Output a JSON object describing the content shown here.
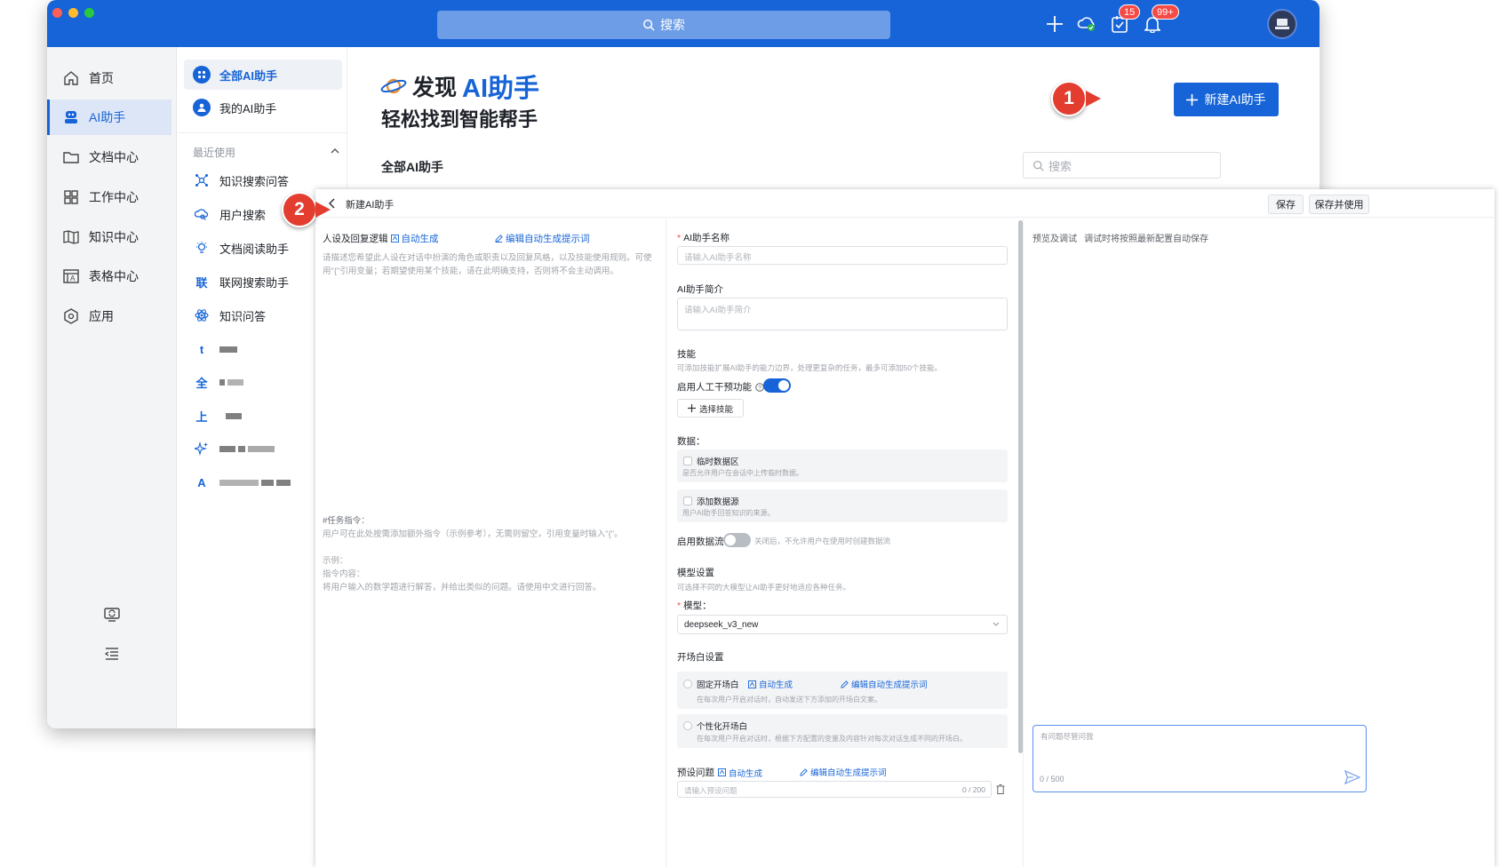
{
  "topbar": {
    "search_label": "搜索",
    "todo_badge": "15",
    "notify_badge": "99+"
  },
  "nav": {
    "items": [
      {
        "label": "首页",
        "icon": "home-icon"
      },
      {
        "label": "AI助手",
        "icon": "robot-icon"
      },
      {
        "label": "文档中心",
        "icon": "folder-icon"
      },
      {
        "label": "工作中心",
        "icon": "grid-icon"
      },
      {
        "label": "知识中心",
        "icon": "book-icon"
      },
      {
        "label": "表格中心",
        "icon": "table-icon"
      },
      {
        "label": "应用",
        "icon": "hexagon-icon"
      }
    ],
    "active_index": 1
  },
  "sub_sidebar": {
    "all_ai": "全部AI助手",
    "my_ai": "我的AI助手",
    "recent_heading": "最近使用",
    "recent_items": [
      {
        "label": "知识搜索问答",
        "icon": "knowledge-search-icon"
      },
      {
        "label": "用户搜索",
        "icon": "user-search-icon"
      },
      {
        "label": "文档阅读助手",
        "icon": "bulb-icon"
      },
      {
        "label": "联网搜索助手",
        "icon": "web-search-icon",
        "glyph": "联"
      },
      {
        "label": "知识问答",
        "icon": "atom-icon"
      }
    ],
    "blurred_glyphs": [
      "t",
      "全",
      "上",
      "",
      "A"
    ]
  },
  "hero": {
    "prefix": "发现",
    "accent": "AI助手",
    "subtitle": "轻松找到智能帮手"
  },
  "main": {
    "new_button": "新建AI助手",
    "all_label": "全部AI助手",
    "search_placeholder": "搜索"
  },
  "callouts": {
    "one": "1",
    "two": "2"
  },
  "editor": {
    "title": "新建AI助手",
    "save": "保存",
    "save_and_use": "保存并使用",
    "persona": {
      "label": "人设及回复逻辑",
      "auto_generate": "自动生成",
      "edit_prompt": "编辑自动生成提示词",
      "description_1": "请描述您希望此人设在对话中扮演的角色或职责以及回复风格，以及技能使用规则。可使",
      "description_2": "用\"{\"引用变量；若期望使用某个技能，请在此明确支持，否则将不会主动调用。"
    },
    "task": {
      "heading": "#任务指令：",
      "line1": "用户可在此处按需添加额外指令（示例参考），无需则留空，引用变量时输入\"{\"。",
      "example_label": "示例：",
      "content_label": "指令内容：",
      "example_text": "将用户输入的数学题进行解答，并给出类似的问题。请使用中文进行回答。"
    },
    "name": {
      "label": "AI助手名称",
      "placeholder": "请输入AI助手名称"
    },
    "intro": {
      "label": "AI助手简介",
      "placeholder": "请输入AI助手简介"
    },
    "skills": {
      "label": "技能",
      "hint": "可添加技能扩展AI助手的能力边界，处理更复杂的任务，最多可添加50个技能。",
      "manual_label": "启用人工干预功能",
      "manual_enabled": true,
      "select_button": "选择技能"
    },
    "data": {
      "label": "数据：",
      "temp_title": "临时数据区",
      "temp_desc": "是否允许用户在会话中上传临时数据。",
      "source_title": "添加数据源",
      "source_desc": "用户AI助手回答知识的来源。",
      "stream_label": "启用数据流",
      "stream_enabled": false,
      "stream_hint": "关闭后，不允许用户在使用时创建数据流"
    },
    "model": {
      "label": "模型设置",
      "hint": "可选择不同的大模型让AI助手更好地适应各种任务。",
      "model_label": "模型：",
      "model_value": "deepseek_v3_new"
    },
    "opening": {
      "label": "开场白设置",
      "fixed_title": "固定开场白",
      "auto_generate": "自动生成",
      "edit_prompt": "编辑自动生成提示词",
      "fixed_desc": "在每次用户开启对话时，自动发送下方添加的开场白文案。",
      "personal_title": "个性化开场白",
      "personal_desc": "在每次用户开启对话时，根据下方配置的变量及内容针对每次对话生成不同的开场白。"
    },
    "preset": {
      "label": "预设问题",
      "auto_generate": "自动生成",
      "edit_prompt": "编辑自动生成提示词",
      "placeholder": "请输入预设问题",
      "counter": "0 / 200"
    },
    "preview": {
      "title": "预览及调试",
      "hint": "调试时将按照最新配置自动保存",
      "chat_placeholder": "有问题尽管问我",
      "chat_counter": "0 / 500"
    }
  },
  "colors": {
    "brand": "#1664d7",
    "callout": "#e23d2f",
    "badge": "#f54a45"
  }
}
